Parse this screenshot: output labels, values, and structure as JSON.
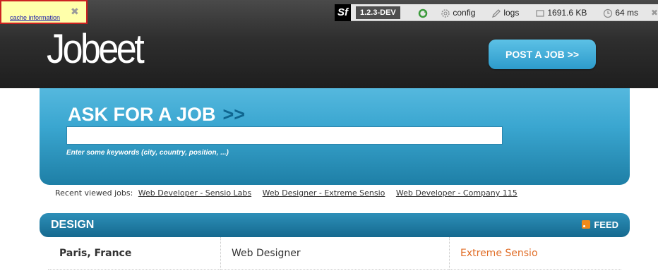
{
  "header": {
    "logo": "Jobeet",
    "post_job_label": "POST A JOB >>"
  },
  "debug": {
    "cache_link": "cache information",
    "close_glyph": "✖",
    "sf": "Sf",
    "version": "1.2.3-DEV",
    "config": "config",
    "logs": "logs",
    "memory": "1691.6 KB",
    "time": "64 ms"
  },
  "search": {
    "title": "ASK FOR A JOB",
    "arrows": ">>",
    "value": "",
    "help": "Enter some keywords (city, country, position, ...)"
  },
  "recent": {
    "label": "Recent viewed jobs:",
    "jobs": [
      "Web Developer - Sensio Labs",
      "Web Designer - Extreme Sensio",
      "Web Developer - Company 115"
    ]
  },
  "category": {
    "name": "DESIGN",
    "feed_label": "FEED",
    "rows": [
      {
        "location": "Paris, France",
        "position": "Web Designer",
        "company": "Extreme Sensio"
      }
    ]
  },
  "colors": {
    "accent": "#3aa6d0",
    "company": "#e06c25"
  }
}
